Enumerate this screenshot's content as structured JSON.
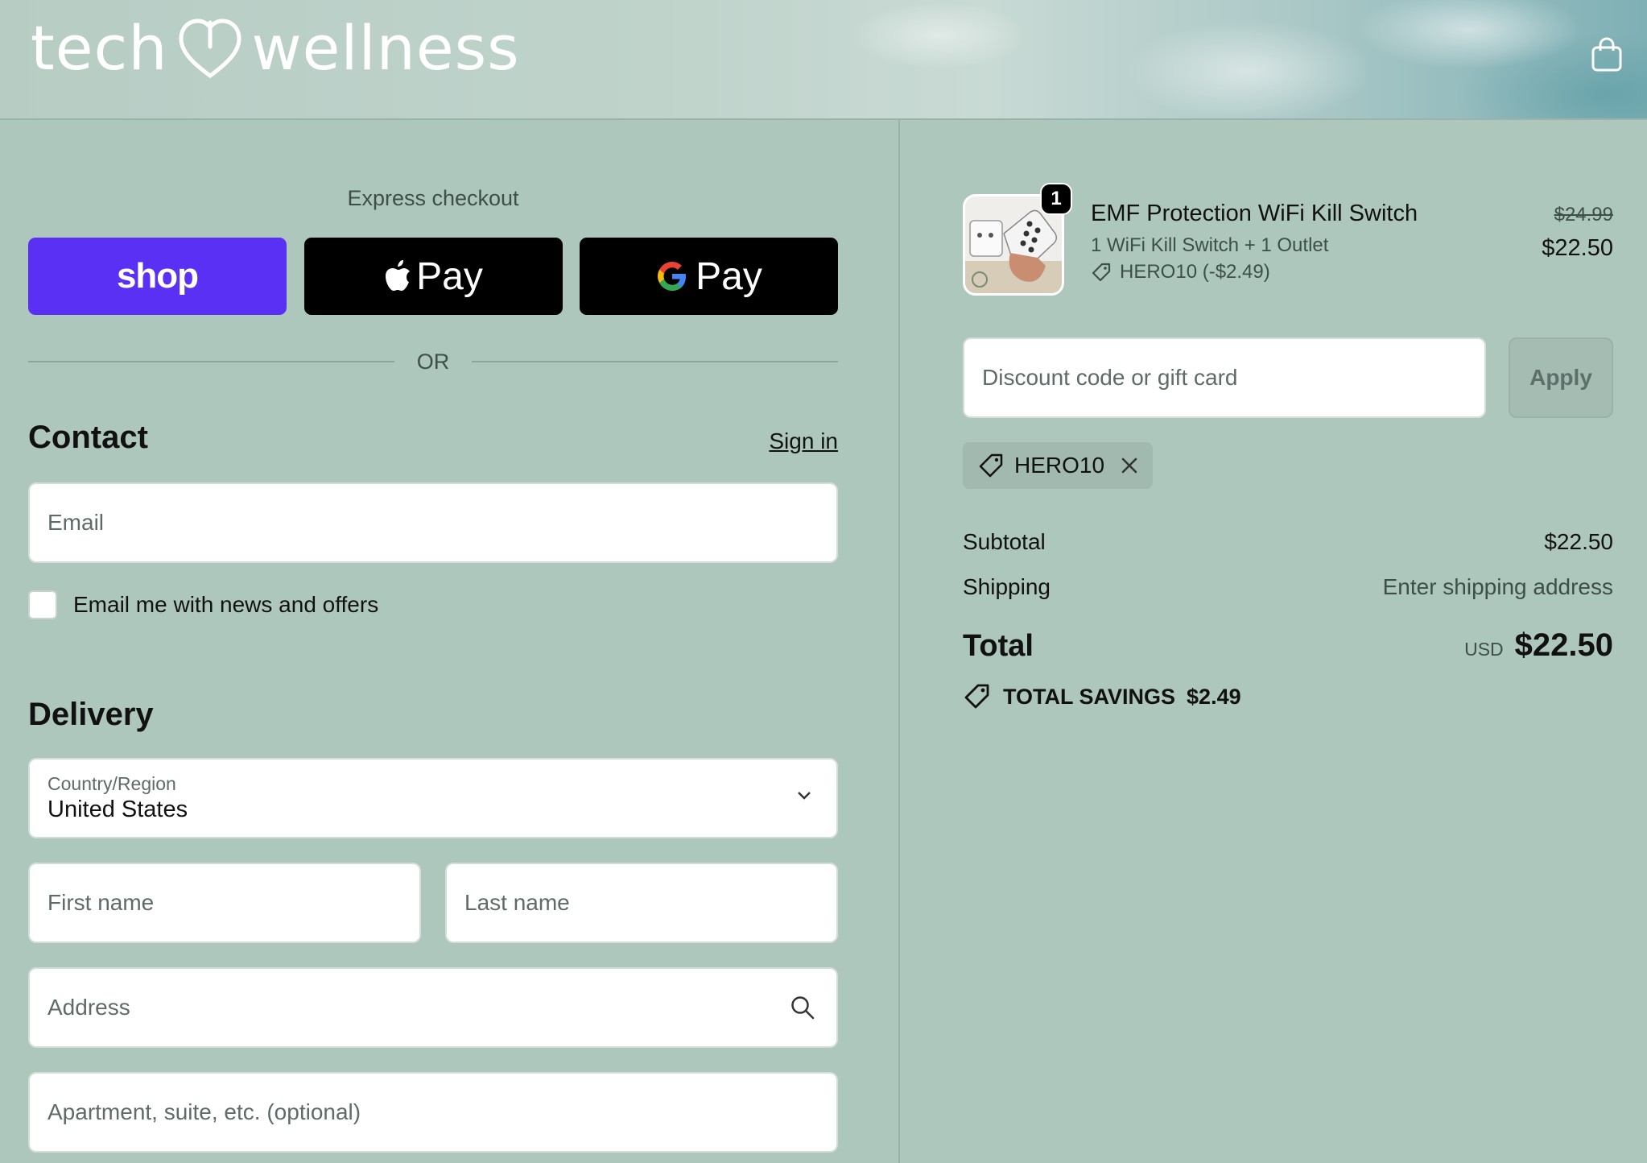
{
  "header": {
    "logo_left": "tech",
    "logo_right": "wellness",
    "cart_icon": "shopping-bag-icon"
  },
  "express": {
    "title": "Express checkout",
    "shop_label": "shop",
    "apple_label": "Pay",
    "gpay_label": "Pay",
    "or_label": "OR"
  },
  "contact": {
    "heading": "Contact",
    "sign_in": "Sign in",
    "email_placeholder": "Email",
    "newsletter_label": "Email me with news and offers"
  },
  "delivery": {
    "heading": "Delivery",
    "country_label": "Country/Region",
    "country_value": "United States",
    "first_name_placeholder": "First name",
    "last_name_placeholder": "Last name",
    "address_placeholder": "Address",
    "apartment_placeholder": "Apartment, suite, etc. (optional)"
  },
  "order": {
    "quantity": "1",
    "product_name": "EMF Protection WiFi Kill Switch",
    "variant": "1 WiFi Kill Switch + 1 Outlet",
    "discount_line": "HERO10 (-$2.49)",
    "original_price": "$24.99",
    "price": "$22.50",
    "discount_placeholder": "Discount code or gift card",
    "apply_label": "Apply",
    "applied_code": "HERO10",
    "subtotal_label": "Subtotal",
    "subtotal_value": "$22.50",
    "shipping_label": "Shipping",
    "shipping_value": "Enter shipping address",
    "total_label": "Total",
    "currency": "USD",
    "total_value": "$22.50",
    "savings_label": "TOTAL SAVINGS",
    "savings_value": "$2.49"
  },
  "colors": {
    "background": "#aec7bc",
    "shop_pay": "#5a31f4",
    "button_black": "#000000"
  }
}
